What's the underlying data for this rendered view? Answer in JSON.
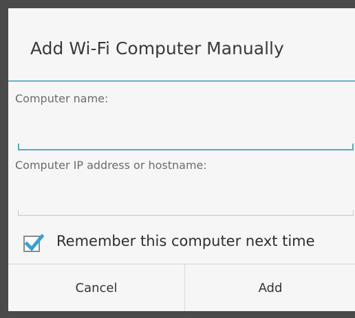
{
  "dialog": {
    "title": "Add Wi-Fi Computer Manually",
    "fields": [
      {
        "label": "Computer name:",
        "value": "",
        "placeholder": ""
      },
      {
        "label": "Computer IP address or hostname:",
        "value": "",
        "placeholder": ""
      }
    ],
    "remember": {
      "label": "Remember this computer next time",
      "checked": true
    },
    "buttons": {
      "cancel": "Cancel",
      "add": "Add"
    }
  },
  "colors": {
    "accent": "#4fa9c9",
    "dialog_background": "#f6f6f6",
    "frame": "#4a4a4a"
  },
  "icons": {
    "checkbox_mark": "checkmark-icon"
  }
}
